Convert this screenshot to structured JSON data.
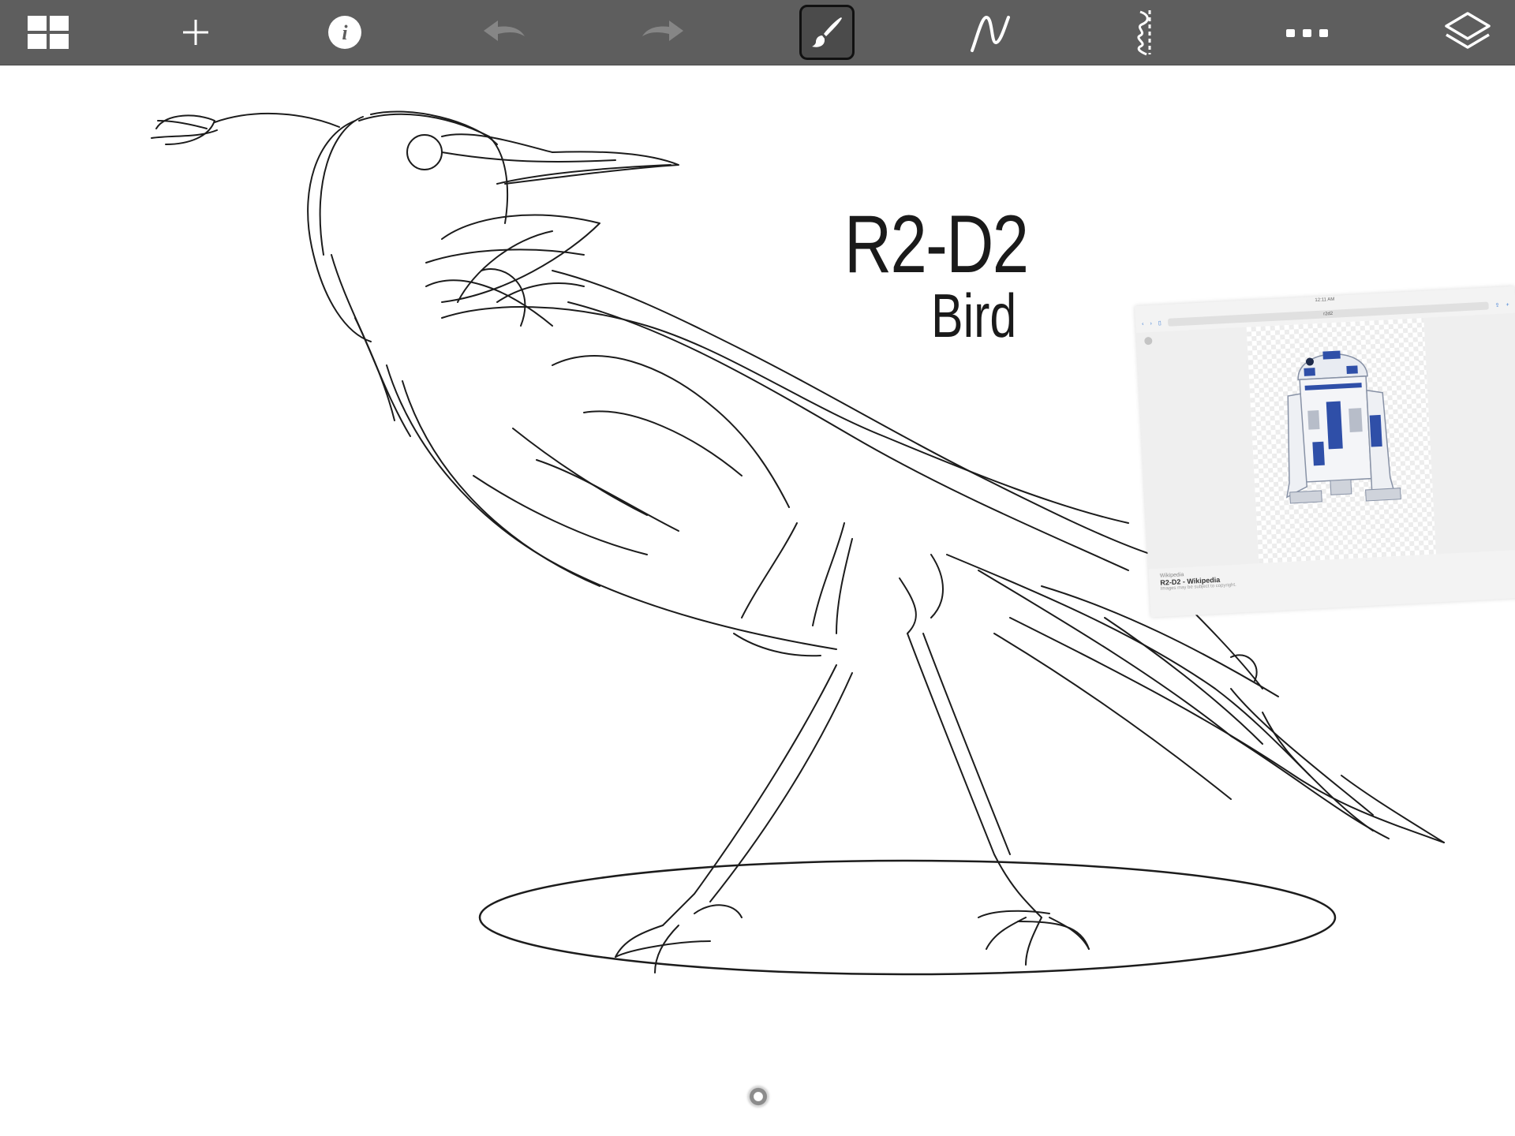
{
  "toolbar": {
    "buttons": [
      {
        "name": "gallery",
        "icon": "gallery-grid-icon"
      },
      {
        "name": "add",
        "icon": "plus-icon"
      },
      {
        "name": "info",
        "icon": "info-icon"
      },
      {
        "name": "undo",
        "icon": "undo-arrow-icon",
        "enabled": false
      },
      {
        "name": "redo",
        "icon": "redo-arrow-icon",
        "enabled": false
      },
      {
        "name": "brush",
        "icon": "brush-icon",
        "selected": true
      },
      {
        "name": "pen-curve",
        "icon": "stroke-curve-icon"
      },
      {
        "name": "symmetry",
        "icon": "symmetry-icon"
      },
      {
        "name": "more",
        "icon": "more-dots-icon"
      },
      {
        "name": "layers",
        "icon": "layers-icon"
      }
    ],
    "colors": {
      "background": "#5e5e5e",
      "icon": "#ffffff",
      "disabled_icon": "#9a9a9a"
    }
  },
  "canvas": {
    "handwriting_title": "R2-D2",
    "handwriting_subtitle": "Bird"
  },
  "reference_image": {
    "status_time": "12:11 AM",
    "url": "r2d2",
    "source": "Wikipedia",
    "title": "R2-D2 - Wikipedia",
    "note": "Images may be subject to copyright."
  }
}
